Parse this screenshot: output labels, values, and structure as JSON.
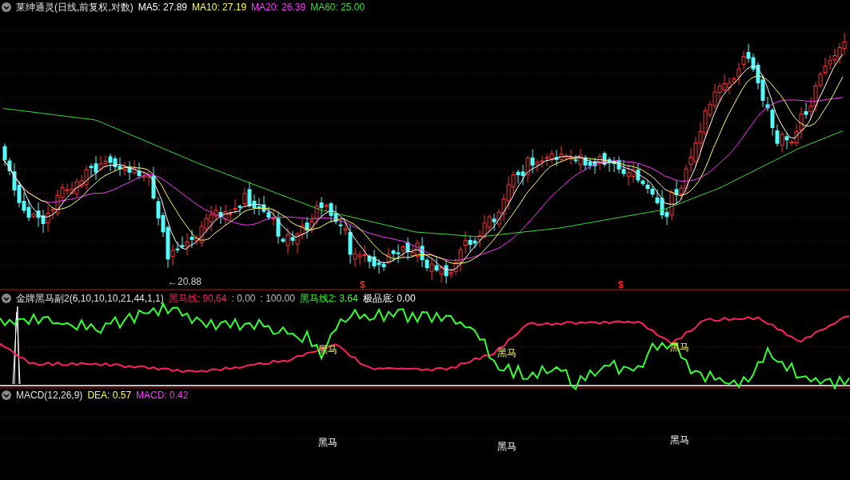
{
  "main_panel": {
    "title": "莱绅通灵(日线,前复权,对数)",
    "values": [
      {
        "label": "MA5: 27.89",
        "color": "#ffffff"
      },
      {
        "label": "MA10: 27.19",
        "color": "#ffff33"
      },
      {
        "label": "MA20: 26.39",
        "color": "#ff33ff"
      },
      {
        "label": "MA60: 25.00",
        "color": "#33dd33"
      }
    ],
    "low_label": "←20.88",
    "markers": [
      "$",
      "$"
    ]
  },
  "indicator_panel": {
    "title": "金牌黑马副2(6,10,10,10,21,44,1,1)",
    "values": [
      {
        "label": "黑马线: 90.64",
        "color": "#ff2060"
      },
      {
        "label": ": 0.00",
        "color": "#c0c0c0"
      },
      {
        "label": ": 100.00",
        "color": "#c0c0c0"
      },
      {
        "label": "黑马线2: 3.64",
        "color": "#33ff33"
      },
      {
        "label": "极品底: 0.00",
        "color": "#ffffff"
      }
    ],
    "signals": [
      "黑马",
      "黑马",
      "黑马"
    ]
  },
  "macd_panel": {
    "title": "MACD(12,26,9)",
    "values": [
      {
        "label": "DEA: 0.57",
        "color": "#ffff33"
      },
      {
        "label": "MACD: 0.42",
        "color": "#ff33ff"
      }
    ],
    "signals": [
      "黑马",
      "黑马",
      "黑马"
    ]
  }
}
